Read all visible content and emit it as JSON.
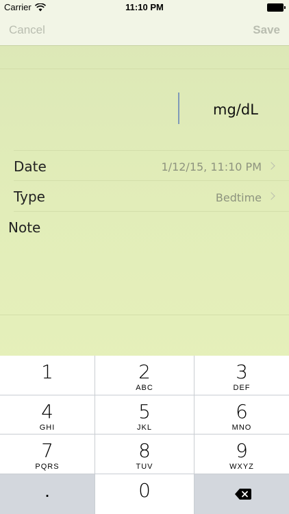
{
  "status_bar": {
    "carrier": "Carrier",
    "time": "11:10 PM",
    "wifi_icon": "wifi-icon",
    "battery_icon": "battery-icon"
  },
  "nav": {
    "cancel_label": "Cancel",
    "save_label": "Save"
  },
  "glucose": {
    "value": "",
    "unit": "mg/dL"
  },
  "rows": {
    "date": {
      "label": "Date",
      "value": "1/12/15, 11:10 PM"
    },
    "type": {
      "label": "Type",
      "value": "Bedtime"
    },
    "note": {
      "label": "Note",
      "value": ""
    }
  },
  "keypad": {
    "keys": [
      {
        "num": "1",
        "letters": ""
      },
      {
        "num": "2",
        "letters": "ABC"
      },
      {
        "num": "3",
        "letters": "DEF"
      },
      {
        "num": "4",
        "letters": "GHI"
      },
      {
        "num": "5",
        "letters": "JKL"
      },
      {
        "num": "6",
        "letters": "MNO"
      },
      {
        "num": "7",
        "letters": "PQRS"
      },
      {
        "num": "8",
        "letters": "TUV"
      },
      {
        "num": "9",
        "letters": "WXYZ"
      }
    ],
    "dot": ".",
    "zero": "0",
    "backspace_icon": "backspace-icon"
  },
  "colors": {
    "background": "#e2edb9",
    "nav_bg": "#f2f5e6",
    "button_disabled": "#b9bdb0",
    "cursor": "#7f99b8"
  }
}
